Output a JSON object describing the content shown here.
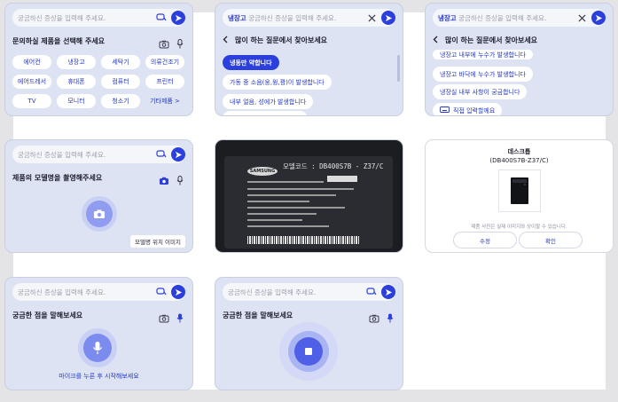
{
  "search": {
    "placeholder": "궁금하신 증상을 입력해 주세요.",
    "category_tag": "냉장고",
    "placeholder_with_tag": "궁금하신 증상을 입력해 주세요."
  },
  "panel_product": {
    "heading": "문의하실 제품을 선택해 주세요",
    "chips": [
      "에어컨",
      "냉장고",
      "세탁기",
      "의류건조기",
      "에어드레서",
      "휴대폰",
      "컴퓨터",
      "프린터",
      "TV",
      "모니터",
      "청소기",
      "기타제품 >"
    ]
  },
  "panel_faq_1": {
    "heading": "많이 하는 질문에서 찾아보세요",
    "questions": [
      "냉동만 약합니다",
      "가동 중 소음(웅,윙,쾅)이 발생합니다",
      "내부 얼음, 성에가 발생합니다"
    ]
  },
  "panel_faq_2": {
    "heading": "많이 하는 질문에서 찾아보세요",
    "questions": [
      "냉장고 내부에 누수가 발생합니다",
      "냉장고 바닥에 누수가 발생합니다",
      "냉장실 내부 사항이 궁금합니다"
    ],
    "direct_input": "직접 입력할께요"
  },
  "panel_camera": {
    "heading": "제품의 모델명을 촬영해주세요",
    "model_position": "모델명 위치 이미지"
  },
  "panel_photo": {
    "brand": "SAMSUNG",
    "model_code_label": "모델코드 : DB400S7B - Z37/C"
  },
  "panel_result": {
    "product_name": "데스크톱",
    "model_code": "(DB400S7B-Z37/C)",
    "note": "제품 사진은 실제 이미지와 상이할 수 있습니다.",
    "edit_label": "수정",
    "confirm_label": "확인"
  },
  "panel_voice_1": {
    "heading": "궁금한 점을 말해보세요",
    "hint": "마이크를 누른 후 시작해보세요"
  },
  "panel_voice_2": {
    "heading": "궁금한 점을 말해보세요"
  },
  "colors": {
    "accent": "#2b3fdc",
    "panel_bg": "#dde3f3",
    "link_text": "#2236c9"
  }
}
